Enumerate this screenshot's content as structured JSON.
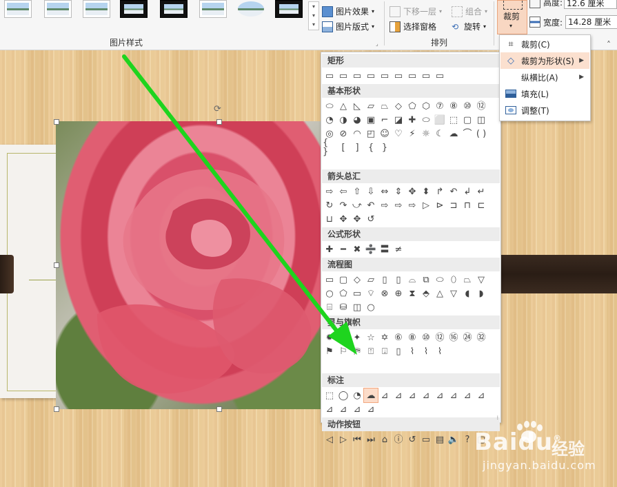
{
  "ribbon": {
    "picture_effects": "图片效果",
    "picture_layout": "图片版式",
    "picture_styles_group": "图片样式",
    "send_backward": "下移一层",
    "selection_pane": "选择窗格",
    "group": "组合",
    "rotate": "旋转",
    "arrange_group": "排列",
    "crop": "裁剪",
    "height_label": "高度:",
    "height_value": "12.6 厘米",
    "width_label": "宽度:",
    "width_value": "14.28 厘米"
  },
  "crop_menu": {
    "items": [
      {
        "label": "裁剪(C)",
        "icon": "crop-icon"
      },
      {
        "label": "裁剪为形状(S)",
        "icon": "crop-to-shape-icon"
      },
      {
        "label": "纵横比(A)",
        "icon": ""
      },
      {
        "label": "填充(L)",
        "icon": "fill-icon"
      },
      {
        "label": "调整(T)",
        "icon": "fit-icon"
      }
    ]
  },
  "shape_gallery": {
    "categories": [
      {
        "label": "矩形",
        "shapes": [
          "▭",
          "▭",
          "▭",
          "▭",
          "▭",
          "▭",
          "▭",
          "▭",
          "▭"
        ]
      },
      {
        "label": "基本形状",
        "shapes": [
          "⬭",
          "△",
          "◺",
          "▱",
          "⏢",
          "◇",
          "⬠",
          "⬡",
          "⑦",
          "⑧",
          "⑩",
          "⑫",
          "◔",
          "◑",
          "◕",
          "▣",
          "⌐",
          "◪",
          "✚",
          "⬭",
          "⬜",
          "⬚",
          "▢",
          "◫",
          "◎",
          "⊘",
          "◠",
          "◰",
          "☺",
          "♡",
          "⚡",
          "☼",
          "☾",
          "☁",
          "⌒",
          "( )",
          "{ }",
          "[",
          "]",
          "{",
          "}"
        ]
      },
      {
        "label": "箭头总汇",
        "shapes": [
          "⇨",
          "⇦",
          "⇧",
          "⇩",
          "⇔",
          "⇕",
          "✥",
          "⬍",
          "↱",
          "↶",
          "↲",
          "↵",
          "↻",
          "↷",
          "⤻",
          "↶",
          "⇨",
          "⇨",
          "⇨",
          "▷",
          "⊳",
          "⊐",
          "⊓",
          "⊏",
          "⊔",
          "✥",
          "✥",
          "↺"
        ]
      },
      {
        "label": "公式形状",
        "shapes": [
          "✚",
          "━",
          "✖",
          "➗",
          "〓",
          "≠"
        ]
      },
      {
        "label": "流程图",
        "shapes": [
          "▭",
          "▢",
          "◇",
          "▱",
          "▯",
          "▯",
          "⌓",
          "⧉",
          "⬭",
          "⬯",
          "⏢",
          "▽",
          "○",
          "⬠",
          "▭",
          "⌔",
          "⊗",
          "⊕",
          "⧗",
          "⬘",
          "△",
          "▽",
          "◖",
          "◗",
          "⌸",
          "⛁",
          "◫",
          "○"
        ]
      },
      {
        "label": "星与旗帜",
        "shapes": [
          "✹",
          "✺",
          "✦",
          "☆",
          "✡",
          "⑥",
          "⑧",
          "⑩",
          "⑫",
          "⑯",
          "㉔",
          "㉜",
          "⚑",
          "⚐",
          "⛿",
          "⍐",
          "⍗",
          "▯",
          "⌇",
          "⌇",
          "⌇"
        ]
      },
      {
        "label": "标注",
        "shapes": [
          "⬚",
          "◯",
          "◔",
          "☁",
          "⊿",
          "⊿",
          "⊿",
          "⊿",
          "⊿",
          "⊿",
          "⊿",
          "⊿",
          "⊿",
          "⊿",
          "⊿",
          "⊿"
        ]
      },
      {
        "label": "动作按钮",
        "shapes": [
          "◁",
          "▷",
          "⏮",
          "⏭",
          "⌂",
          "ⓘ",
          "↺",
          "▭",
          "▤",
          "🔈",
          "?",
          "▢"
        ]
      }
    ],
    "selected_category": 6,
    "selected_index": 3
  },
  "watermark": {
    "brand": "Baidu",
    "brand_cn": "经验",
    "url": "jingyan.baidu.com"
  }
}
